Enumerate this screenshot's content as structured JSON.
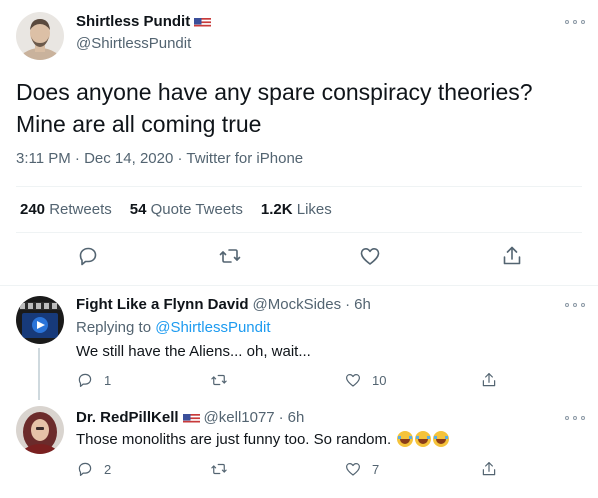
{
  "tweet": {
    "display_name": "Shirtless Pundit",
    "handle": "@ShirtlessPundit",
    "flag_icon": "us-flag-icon",
    "text": "Does anyone have any spare conspiracy theories? Mine are all coming true",
    "time": "3:11 PM",
    "date": "Dec 14, 2020",
    "source": "Twitter for iPhone",
    "retweets_count": "240",
    "retweets_label": "Retweets",
    "quote_count": "54",
    "quote_label": "Quote Tweets",
    "likes_count": "1.2K",
    "likes_label": "Likes"
  },
  "replies": [
    {
      "display_name": "Fight Like a Flynn David",
      "handle": "@MockSides",
      "time": "6h",
      "replying_prefix": "Replying to",
      "replying_to": "@ShirtlessPundit",
      "text": "We still have the Aliens... oh, wait...",
      "reply_count": "1",
      "retweet_count": "",
      "like_count": "10"
    },
    {
      "display_name": "Dr. RedPillKell",
      "handle": "@kell1077",
      "time": "6h",
      "text": "Those monoliths are just funny too. So random.",
      "emoji": "joy-emoji",
      "reply_count": "2",
      "retweet_count": "",
      "like_count": "7"
    }
  ],
  "colors": {
    "text": "#0f1419",
    "secondary": "#536471",
    "link": "#1d9bf0",
    "border": "#eff3f4"
  }
}
